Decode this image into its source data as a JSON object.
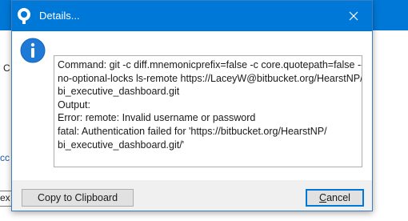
{
  "background": {
    "fragment_c": "C",
    "fragment_link": "cc",
    "fragment_input": "ex"
  },
  "dialog": {
    "title": "Details...",
    "message_lines": [
      "Command: git -c diff.mnemonicprefix=false -c core.quotepath=false --",
      "no-optional-locks ls-remote https://LaceyW@bitbucket.org/HearstNP/",
      "bi_executive_dashboard.git",
      "Output:",
      "Error: remote: Invalid username or password",
      "fatal: Authentication failed for 'https://bitbucket.org/HearstNP/",
      "bi_executive_dashboard.git/'"
    ],
    "copy_button_label": "Copy to Clipboard",
    "cancel_button_label_underlined": "C",
    "cancel_button_label_rest": "ancel"
  },
  "icons": {
    "app": "sourcetree-icon",
    "close": "close-icon",
    "info": "info-icon"
  },
  "colors": {
    "accent": "#0078d7",
    "dialog_bg": "#f0f0f0",
    "info_blue": "#1e7ad6"
  }
}
